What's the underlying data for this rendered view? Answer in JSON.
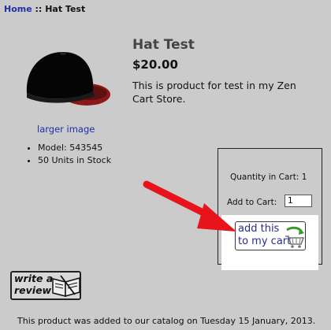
{
  "breadcrumb": {
    "home": "Home",
    "separator": "::",
    "current": "Hat Test"
  },
  "product": {
    "title": "Hat Test",
    "price": "$20.00",
    "description": "This is product for test in my Zen Cart Store.",
    "larger_image_link": "larger image",
    "details": [
      "Model: 543545",
      "50 Units in Stock"
    ]
  },
  "cart": {
    "quantity_label": "Quantity in Cart: 1",
    "add_label": "Add to Cart:",
    "quantity_value": "1",
    "button_line1": "add this",
    "button_line2": "to my cart",
    "button_icon": "cart-icon"
  },
  "review": {
    "line1": "write a",
    "line2": "review",
    "icon": "book-icon"
  },
  "footer": {
    "date_added": "This product was added to our catalog on Tuesday 15 January, 2013."
  },
  "colors": {
    "background": "#cbcbcb",
    "link": "#1d2fa8",
    "arrow": "#e8141b",
    "hat_brim": "#8a1a1a"
  }
}
